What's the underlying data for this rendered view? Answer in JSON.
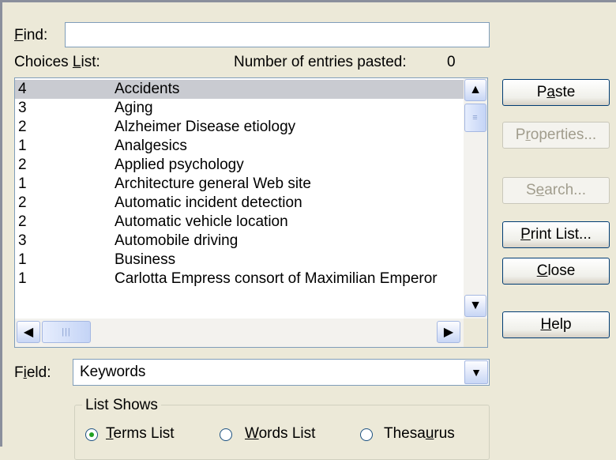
{
  "find": {
    "label": "Find:",
    "value": ""
  },
  "choices": {
    "label": "Choices List:",
    "entries_label": "Number of entries pasted:",
    "entries_count": "0"
  },
  "list": {
    "rows": [
      {
        "count": "4",
        "term": "Accidents",
        "selected": true
      },
      {
        "count": "3",
        "term": "Aging"
      },
      {
        "count": "2",
        "term": "Alzheimer Disease etiology"
      },
      {
        "count": "1",
        "term": "Analgesics"
      },
      {
        "count": "2",
        "term": "Applied psychology"
      },
      {
        "count": "1",
        "term": "Architecture general Web site"
      },
      {
        "count": "2",
        "term": "Automatic incident detection"
      },
      {
        "count": "2",
        "term": "Automatic vehicle location"
      },
      {
        "count": "3",
        "term": "Automobile driving"
      },
      {
        "count": "1",
        "term": "Business"
      },
      {
        "count": "1",
        "term": "Carlotta Empress consort of Maximilian Emperor"
      }
    ]
  },
  "buttons": {
    "paste": "Paste",
    "properties": "Properties...",
    "search": "Search...",
    "print_list": "Print List...",
    "close": "Close",
    "help": "Help"
  },
  "field": {
    "label": "Field:",
    "value": "Keywords"
  },
  "list_shows": {
    "title": "List Shows",
    "options": [
      "Terms List",
      "Words List",
      "Thesaurus"
    ],
    "selected": "Terms List"
  },
  "icons": {
    "scroll_up": "arrow-up-icon",
    "scroll_down": "arrow-down-icon",
    "scroll_left": "arrow-left-icon",
    "scroll_right": "arrow-right-icon",
    "dropdown": "chevron-down-icon"
  },
  "colors": {
    "dialog_bg": "#ece9d8",
    "selection_bg": "#c9cbd1",
    "button_border": "#003c74",
    "disabled_text": "#a19d8d"
  }
}
